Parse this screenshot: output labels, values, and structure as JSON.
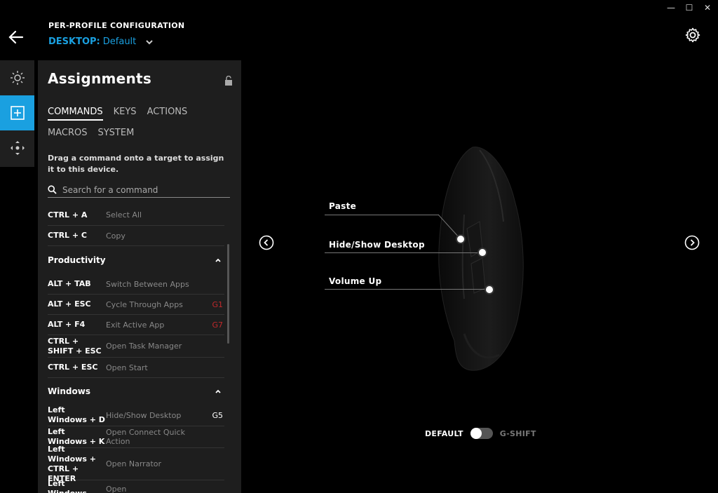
{
  "window": {
    "minimize": "—",
    "maximize": "☐",
    "close": "✕"
  },
  "header": {
    "title": "PER-PROFILE CONFIGURATION",
    "profile_prefix": "DESKTOP:",
    "profile_name": "Default"
  },
  "panel": {
    "title": "Assignments",
    "tabs": [
      "COMMANDS",
      "KEYS",
      "ACTIONS",
      "MACROS",
      "SYSTEM"
    ],
    "hint": "Drag a command onto a target to assign it to this device.",
    "search_placeholder": "Search for a command",
    "top_rows": [
      {
        "key": "CTRL + A",
        "desc": "Select All",
        "g": ""
      },
      {
        "key": "CTRL + C",
        "desc": "Copy",
        "g": ""
      }
    ],
    "sections": [
      {
        "title": "Productivity",
        "rows": [
          {
            "key": "ALT + TAB",
            "desc": "Switch Between Apps",
            "g": ""
          },
          {
            "key": "ALT + ESC",
            "desc": "Cycle Through Apps",
            "g": "G1"
          },
          {
            "key": "ALT + F4",
            "desc": "Exit Active App",
            "g": "G7"
          },
          {
            "key": "CTRL + SHIFT + ESC",
            "desc": "Open Task Manager",
            "g": ""
          },
          {
            "key": "CTRL + ESC",
            "desc": "Open Start",
            "g": ""
          }
        ]
      },
      {
        "title": "Windows",
        "rows": [
          {
            "key": "Left Windows + D",
            "desc": "Hide/Show Desktop",
            "g": "G5"
          },
          {
            "key": "Left Windows + K",
            "desc": "Open Connect Quick Action",
            "g": ""
          },
          {
            "key": "Left Windows + CTRL + ENTER",
            "desc": "Open Narrator",
            "g": ""
          },
          {
            "key": "Left Windows",
            "desc": "Open",
            "g": ""
          }
        ]
      }
    ]
  },
  "callouts": [
    {
      "label": "Paste"
    },
    {
      "label": "Hide/Show Desktop"
    },
    {
      "label": "Volume Up"
    }
  ],
  "toggle": {
    "left_label": "DEFAULT",
    "right_label": "G-SHIFT",
    "state": "DEFAULT"
  },
  "colors": {
    "accent": "#1aa0e0",
    "assigned_red": "#c0292b",
    "panel_bg": "#1e1e1e"
  }
}
